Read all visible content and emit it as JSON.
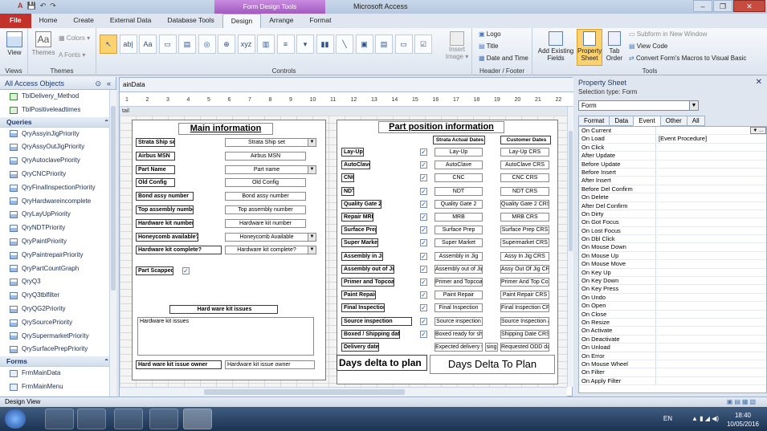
{
  "window": {
    "context_tab": "Form Design Tools",
    "app_title": "Microsoft Access",
    "min": "–",
    "max": "❐",
    "close": "✕"
  },
  "ribbon_tabs": [
    "File",
    "Home",
    "Create",
    "External Data",
    "Database Tools",
    "Design",
    "Arrange",
    "Format"
  ],
  "ribbon": {
    "views": {
      "view_label": "View",
      "group": "Views"
    },
    "themes": {
      "themes_label": "Themes",
      "colors": "Colors ▾",
      "fonts": "Fonts ▾",
      "group": "Themes"
    },
    "controls": {
      "group": "Controls",
      "insert_image": "Insert\nImage ▾"
    },
    "header_footer": {
      "logo": "Logo",
      "title": "Title",
      "date_time": "Date and Time",
      "group": "Header / Footer"
    },
    "tools": {
      "add_existing_fields": "Add Existing\nFields",
      "property_sheet": "Property\nSheet",
      "tab_order": "Tab\nOrder",
      "subform_in_new_window": "Subform in New Window",
      "view_code": "View Code",
      "convert_macros": "Convert Form's Macros to Visual Basic",
      "group": "Tools"
    }
  },
  "nav_pane": {
    "title": "All Access Objects",
    "top_items": [
      "TblDelivery_Method",
      "TblPositiveleadtimes"
    ],
    "queries_header": "Queries",
    "queries": [
      "QryAssyinJigPriority",
      "QryAssyOutJigPriority",
      "QryAutoclavePriority",
      "QryCNCPriority",
      "QryFinalInspectionPriority",
      "QryHardwareincomplete",
      "QryLayUpPriority",
      "QryNDTPriority",
      "QryPaintPriority",
      "QryPaintrepairPriority",
      "QryPartCountGraph",
      "QryQ3",
      "QryQ3tblfilter",
      "QryQG2Priority",
      "QrySourcePriority",
      "QrySupermarketPriority",
      "QrySurfacePrepPriority"
    ],
    "forms_header": "Forms",
    "forms": [
      "FrmMainData",
      "FrmMainMenu"
    ]
  },
  "design": {
    "doc_tab": "ainData",
    "ruler_marks": [
      "1",
      "2",
      "3",
      "4",
      "5",
      "6",
      "7",
      "8",
      "9",
      "10",
      "11",
      "12",
      "13",
      "14",
      "15",
      "16",
      "17",
      "18",
      "19",
      "20",
      "21",
      "22"
    ],
    "section_label": "tail",
    "main_info": {
      "title": "Main information",
      "rows": [
        {
          "label": "Strata Ship set",
          "field": "Strata Ship set",
          "combo": true
        },
        {
          "label": "Airbus MSN",
          "field": "Airbus MSN",
          "combo": false
        },
        {
          "label": "Part Name",
          "field": "Part name",
          "combo": true
        },
        {
          "label": "Old Config",
          "field": "Old Config",
          "combo": false
        },
        {
          "label": "Bond assy number",
          "field": "Bond assy number",
          "combo": false
        },
        {
          "label": "Top assembly number",
          "field": "Top assembly number",
          "combo": false
        },
        {
          "label": "Hardware kit number",
          "field": "Hardware kit number",
          "combo": false
        },
        {
          "label": "Honeycomb available?",
          "field": "Honeycomb Available",
          "combo": true
        },
        {
          "label": "Hardware kit complete?",
          "field": "Hardware kit complete?",
          "combo": true
        }
      ],
      "part_scrapped": "Part Scapped",
      "kit_issues_label": "Hard ware kit issues",
      "kit_issues_field": "Hardware kit issues",
      "issue_owner_label": "Hard ware kit issue owner",
      "issue_owner_field": "Hardware kit issue owner"
    },
    "part_position": {
      "title": "Part position information",
      "col_strata": "Strata Actual Dates",
      "col_customer": "Customer Dates",
      "rows": [
        {
          "label": "Lay-Up",
          "strata": "Lay-Up",
          "customer": "Lay-Up CRS"
        },
        {
          "label": "AutoClave",
          "strata": "AutoClave",
          "customer": "AutoClave CRS"
        },
        {
          "label": "CNC",
          "strata": "CNC",
          "customer": "CNC CRS"
        },
        {
          "label": "NDT",
          "strata": "NDT",
          "customer": "NDT CRS"
        },
        {
          "label": "Quality Gate 2",
          "strata": "Quality Gate 2",
          "customer": "Quality Gate 2 CRS"
        },
        {
          "label": "Repair MRB",
          "strata": "MRB",
          "customer": "MRB CRS"
        },
        {
          "label": "Surface Prep",
          "strata": "Surface Prep",
          "customer": "Surface Prep CRS"
        },
        {
          "label": "Super Market",
          "strata": "Super Market",
          "customer": "Supermarket CRS"
        },
        {
          "label": "Assembly in Jig",
          "strata": "Assembly in Jig",
          "customer": "Assy In Jig CRS"
        },
        {
          "label": "Assembly out of Jig",
          "strata": "Assembly out of Jig",
          "customer": "Assy Out Of Jig CRS"
        },
        {
          "label": "Primer and Topcoat",
          "strata": "Primer and Topcoat",
          "customer": "Primer And Top Coat"
        },
        {
          "label": "Paint Repair",
          "strata": "Paint Repair",
          "customer": "Paint Repair CRS"
        },
        {
          "label": "Final Inspection",
          "strata": "Final Inspection",
          "customer": "Final Inspection CRS"
        },
        {
          "label": "Source inspection",
          "strata": "Source inspection",
          "customer": "Source Inspection and Pack"
        },
        {
          "label": "Boxed / Shipping date",
          "strata": "Boxed ready for shipment",
          "customer": "Shipping Date CRS"
        }
      ],
      "delivery_label": "Delivery date",
      "delivery_strata": "Expected delivery to HL",
      "delivery_extra": "sing",
      "delivery_customer": "Requested ODD date from",
      "days_delta_label": "Days delta to plan",
      "days_delta_field": "Days Delta To Plan"
    }
  },
  "property_sheet": {
    "title": "Property Sheet",
    "selection_type": "Selection type:  Form",
    "object": "Form",
    "tabs": [
      "Format",
      "Data",
      "Event",
      "Other",
      "All"
    ],
    "active_tab": "Event",
    "rows": [
      {
        "k": "On Current",
        "v": ""
      },
      {
        "k": "On Load",
        "v": "[Event Procedure]"
      },
      {
        "k": "On Click",
        "v": ""
      },
      {
        "k": "After Update",
        "v": ""
      },
      {
        "k": "Before Update",
        "v": ""
      },
      {
        "k": "Before Insert",
        "v": ""
      },
      {
        "k": "After Insert",
        "v": ""
      },
      {
        "k": "Before Del Confirm",
        "v": ""
      },
      {
        "k": "On Delete",
        "v": ""
      },
      {
        "k": "After Del Confirm",
        "v": ""
      },
      {
        "k": "On Dirty",
        "v": ""
      },
      {
        "k": "On Got Focus",
        "v": ""
      },
      {
        "k": "On Lost Focus",
        "v": ""
      },
      {
        "k": "On Dbl Click",
        "v": ""
      },
      {
        "k": "On Mouse Down",
        "v": ""
      },
      {
        "k": "On Mouse Up",
        "v": ""
      },
      {
        "k": "On Mouse Move",
        "v": ""
      },
      {
        "k": "On Key Up",
        "v": ""
      },
      {
        "k": "On Key Down",
        "v": ""
      },
      {
        "k": "On Key Press",
        "v": ""
      },
      {
        "k": "On Undo",
        "v": ""
      },
      {
        "k": "On Open",
        "v": ""
      },
      {
        "k": "On Close",
        "v": ""
      },
      {
        "k": "On Resize",
        "v": ""
      },
      {
        "k": "On Activate",
        "v": ""
      },
      {
        "k": "On Deactivate",
        "v": ""
      },
      {
        "k": "On Unload",
        "v": ""
      },
      {
        "k": "On Error",
        "v": ""
      },
      {
        "k": "On Mouse Wheel",
        "v": ""
      },
      {
        "k": "On Filter",
        "v": ""
      },
      {
        "k": "On Apply Filter",
        "v": ""
      }
    ]
  },
  "status": {
    "text": "Design View"
  },
  "taskbar": {
    "lang": "EN",
    "time": "18:40",
    "date": "10/05/2016"
  }
}
